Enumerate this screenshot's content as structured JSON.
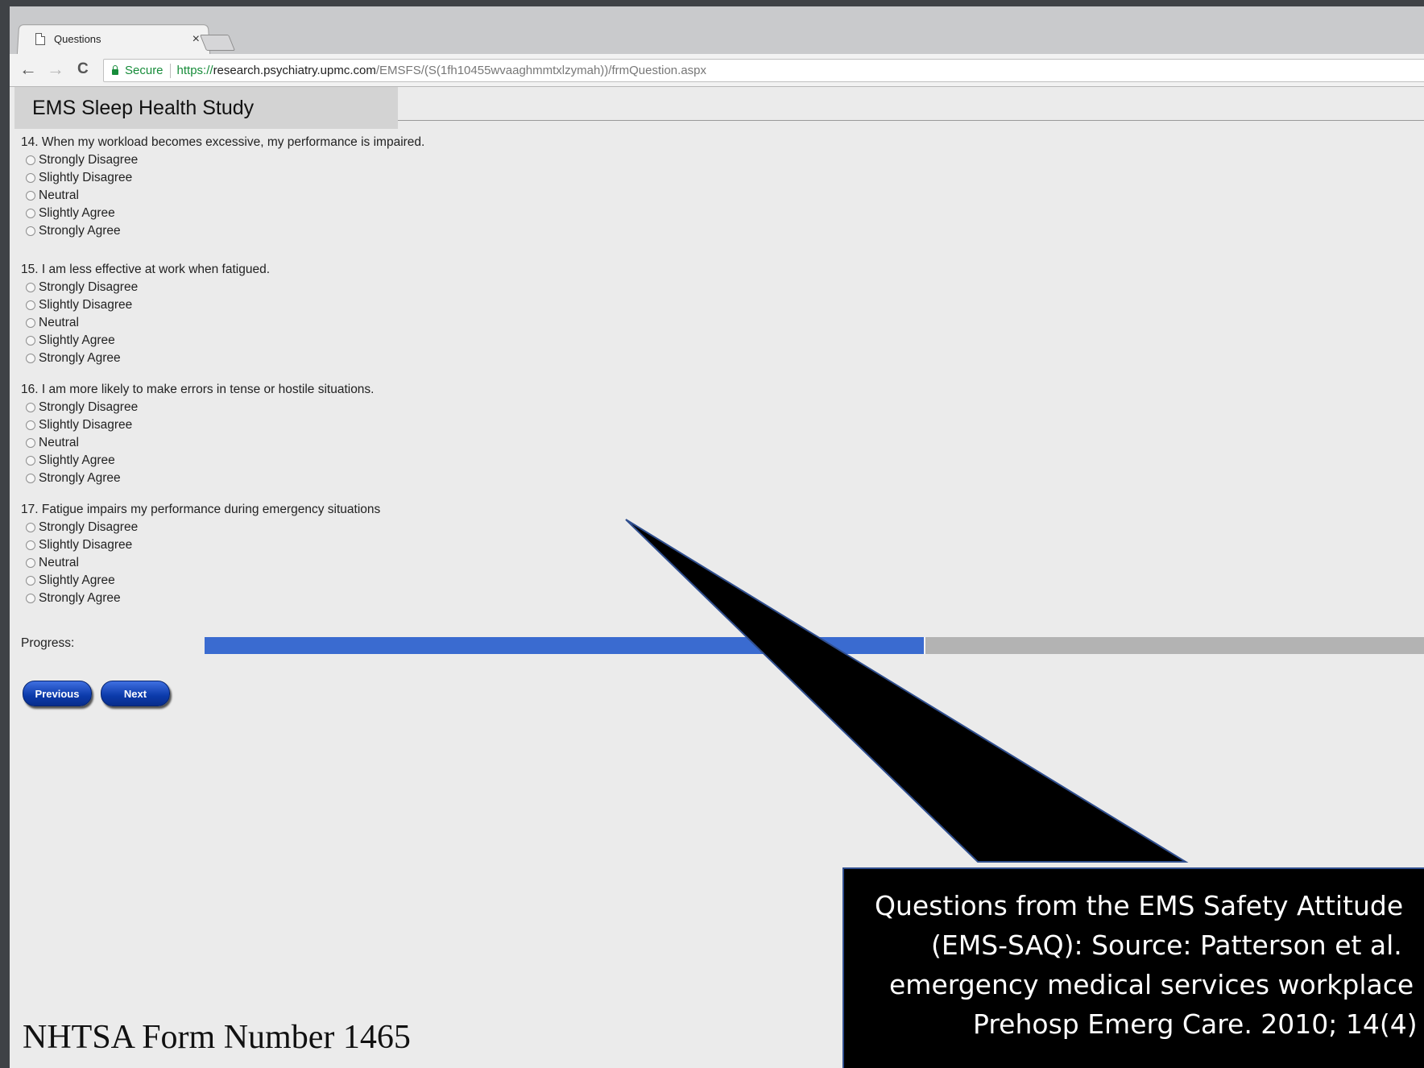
{
  "browser": {
    "tab_title": "Questions",
    "tab_close": "×",
    "back": "←",
    "forward": "→",
    "reload": "C",
    "secure_label": "Secure",
    "url_scheme": "https://",
    "url_host": "research.psychiatry.upmc.com",
    "url_path": "/EMSFS/(S(1fh10455wvaaghmmtxlzymah))/frmQuestion.aspx"
  },
  "header": {
    "title": "EMS Sleep Health Study"
  },
  "questions": [
    {
      "text": "14. When my workload becomes excessive, my performance is impaired.",
      "options": [
        "Strongly Disagree",
        "Slightly Disagree",
        "Neutral",
        "Slightly Agree",
        "Strongly Agree"
      ]
    },
    {
      "text": "15. I am less effective at work when fatigued.",
      "options": [
        "Strongly Disagree",
        "Slightly Disagree",
        "Neutral",
        "Slightly Agree",
        "Strongly Agree"
      ]
    },
    {
      "text": "16. I am more likely to make errors in tense or hostile situations.",
      "options": [
        "Strongly Disagree",
        "Slightly Disagree",
        "Neutral",
        "Slightly Agree",
        "Strongly Agree"
      ]
    },
    {
      "text": "17. Fatigue impairs my performance during emergency situations",
      "options": [
        "Strongly Disagree",
        "Slightly Disagree",
        "Neutral",
        "Slightly Agree",
        "Strongly Agree"
      ]
    }
  ],
  "progress": {
    "label": "Progress:",
    "fraction_complete": 0.59
  },
  "buttons": {
    "previous": "Previous",
    "next": "Next"
  },
  "footer": {
    "form_number": "NHTSA Form Number 1465"
  },
  "callout": {
    "lines": [
      "Questions from the EMS Safety Attitude",
      "(EMS-SAQ): Source: Patterson et al.",
      "emergency medical services workplace",
      "Prehosp Emerg Care. 2010; 14(4)"
    ]
  },
  "colors": {
    "progress_fill": "#3a6bd0",
    "progress_track": "#b3b3b3",
    "secure_green": "#178c3a",
    "button_blue": "#0b3aaa"
  }
}
